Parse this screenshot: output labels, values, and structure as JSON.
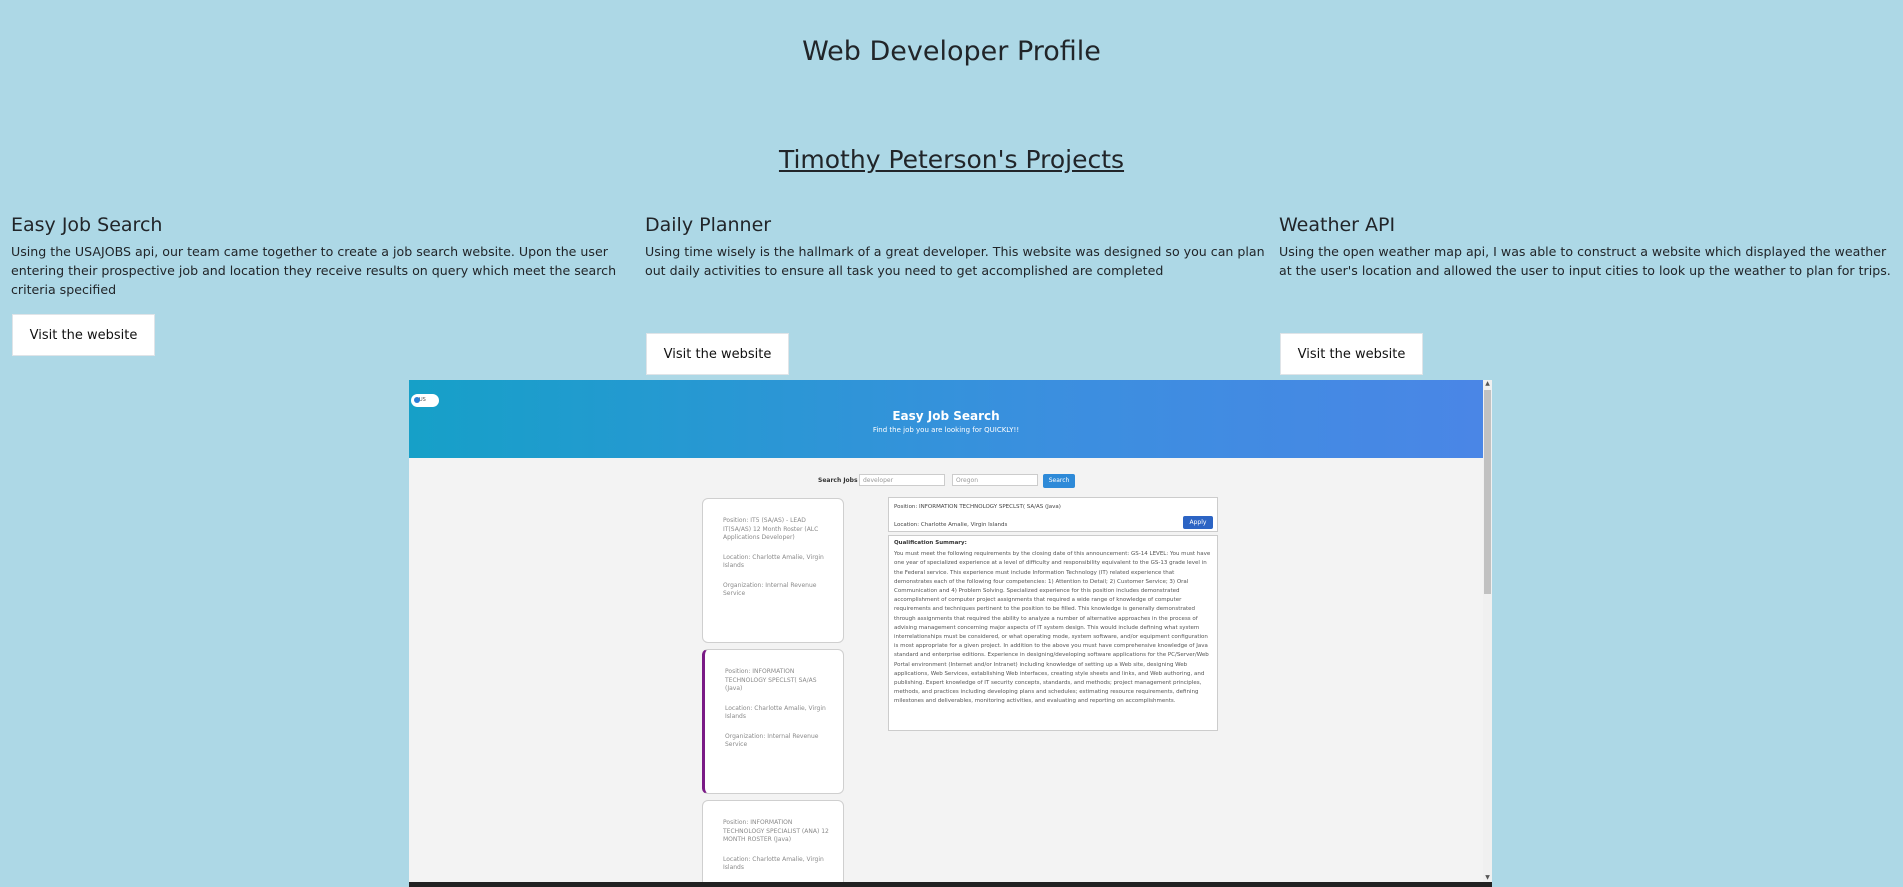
{
  "header": {
    "title": "Web Developer Profile",
    "projects_heading": "Timothy Peterson's Projects"
  },
  "projects": [
    {
      "title": "Easy Job Search",
      "description": "Using the USAJOBS api, our team came together to create a job search website. Upon the user entering their prospective job and location they receive results on query which meet the search criteria specified",
      "button_label": "Visit the website"
    },
    {
      "title": "Daily Planner",
      "description": "Using time wisely is the hallmark of a great developer. This website was designed so you can plan out daily activities to ensure all task you need to get accomplished are completed",
      "button_label": "Visit the website"
    },
    {
      "title": "Weather API",
      "description": "Using the open weather map api, I was able to construct a website which displayed the weather at the user's location and allowed the user to input cities to look up the weather to plan for trips.",
      "button_label": "Visit the website"
    }
  ],
  "screenshot": {
    "toggle_label": "US",
    "hero_title": "Easy Job Search",
    "hero_subtitle": "Find the job you are looking for QUICKLY!!",
    "search_label": "Search Jobs",
    "job_input_value": "developer",
    "location_input_value": "Oregon",
    "search_button": "Search",
    "cards": [
      {
        "position": "Position: IT5 (SA/AS) - LEAD IT(SA/AS) 12 Month Roster (ALC Applications Developer)",
        "location": "Location: Charlotte Amalie, Virgin Islands",
        "organization": "Organization: Internal Revenue Service"
      },
      {
        "position": "Position: INFORMATION TECHNOLOGY SPECLST( SA/AS (Java)",
        "location": "Location: Charlotte Amalie, Virgin Islands",
        "organization": "Organization: Internal Revenue Service"
      },
      {
        "position": "Position: INFORMATION TECHNOLOGY SPECIALIST (ANA) 12 MONTH ROSTER (Java)",
        "location": "Location: Charlotte Amalie, Virgin Islands",
        "organization": ""
      }
    ],
    "detail": {
      "position": "Position: INFORMATION TECHNOLOGY SPECLST( SA/AS (Java)",
      "location": "Location: Charlotte Amalie, Virgin Islands",
      "apply_button": "Apply",
      "qualification_title": "Qualification Summary:",
      "qualification_text": "You must meet the following requirements by the closing date of this announcement: GS-14 LEVEL: You must have one year of specialized experience at a level of difficulty and responsibility equivalent to the GS-13 grade level in the Federal service. This experience must include Information Technology (IT) related experience that demonstrates each of the following four competencies: 1) Attention to Detail; 2) Customer Service; 3) Oral Communication and 4) Problem Solving. Specialized experience for this position includes demonstrated accomplishment of computer project assignments that required a wide range of knowledge of computer requirements and techniques pertinent to the position to be filled. This knowledge is generally demonstrated through assignments that required the ability to analyze a number of alternative approaches in the process of advising management concerning major aspects of IT system design. This would include defining what system interrelationships must be considered, or what operating mode, system software, and/or equipment configuration is most appropriate for a given project. In addition to the above you must have comprehensive knowledge of Java standard and enterprise editions. Experience in designing/developing software applications for the PC/Server/Web Portal environment (Internet and/or Intranet) including knowledge of setting up a Web site, designing Web applications, Web Services, establishing Web interfaces, creating style sheets and links, and Web authoring, and publishing. Expert knowledge of IT security concepts, standards, and methods; project management principles, methods, and practices including developing plans and schedules; estimating resource requirements, defining milestones and deliverables, monitoring activities, and evaluating and reporting on accomplishments."
    }
  }
}
